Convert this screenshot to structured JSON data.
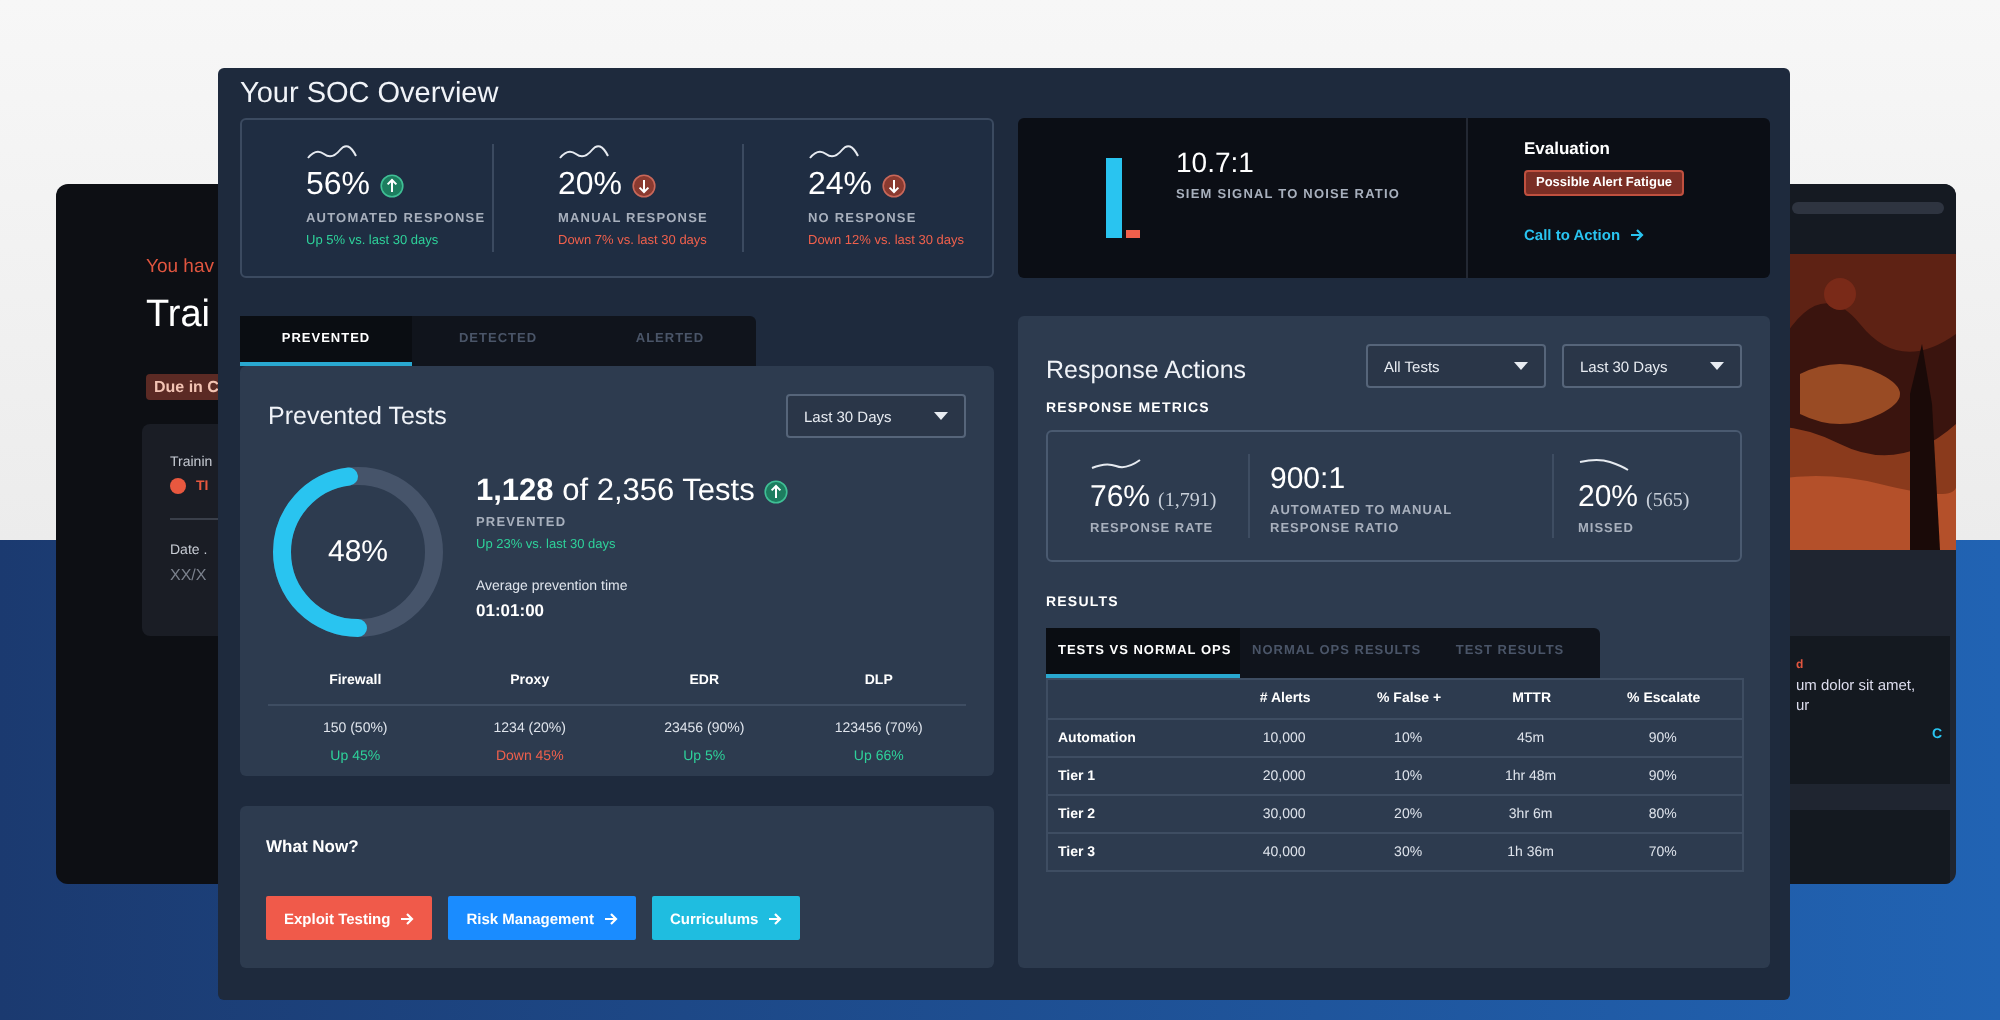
{
  "back_left_card": {
    "notice": "You hav",
    "title": "Trai",
    "badge": "Due in C",
    "field_label": "Trainin",
    "status": "TI",
    "date_label": "Date .",
    "date_value": "XX/X"
  },
  "back_right_card": {
    "tag": "d",
    "lines": "um dolor sit amet,\nur",
    "link": "C"
  },
  "window": {
    "title": "Your SOC Overview"
  },
  "overview_metrics": [
    {
      "value": "56%",
      "rising": true,
      "label": "AUTOMATED RESPONSE",
      "delta": "Up 5% vs. last 30 days"
    },
    {
      "value": "20%",
      "rising": false,
      "label": "MANUAL RESPONSE",
      "delta": "Down 7% vs. last 30 days"
    },
    {
      "value": "24%",
      "rising": false,
      "label": "NO RESPONSE",
      "delta": "Down 12% vs. last 30 days"
    }
  ],
  "siem": {
    "ratio": "10.7:1",
    "label": "SIEM SIGNAL TO NOISE RATIO",
    "evaluation_title": "Evaluation",
    "badge": "Possible Alert Fatigue",
    "link": "Call to Action"
  },
  "tabs": [
    {
      "label": "PREVENTED",
      "selected": true
    },
    {
      "label": "DETECTED",
      "selected": false
    },
    {
      "label": "ALERTED",
      "selected": false
    }
  ],
  "prevented": {
    "title": "Prevented Tests",
    "period": "Last 30 Days",
    "level": 0.48,
    "percent": "48%",
    "count": "1,128",
    "total": "of 2,356 Tests",
    "rising": true,
    "status": "PREVENTED",
    "delta": "Up 23% vs. last 30 days",
    "avg_label": "Average prevention time",
    "avg_value": "01:01:00",
    "controls": [
      {
        "name": "Firewall",
        "value": "150 (50%)",
        "change": "Up 45%",
        "rising": true
      },
      {
        "name": "Proxy",
        "value": "1234 (20%)",
        "change": "Down 45%",
        "rising": false
      },
      {
        "name": "EDR",
        "value": "23456 (90%)",
        "change": "Up 5%",
        "rising": true
      },
      {
        "name": "DLP",
        "value": "123456 (70%)",
        "change": "Up 66%",
        "rising": true
      }
    ]
  },
  "what_now": {
    "title": "What Now?",
    "buttons": [
      {
        "label": "Exploit Testing",
        "color": "#f05a4a"
      },
      {
        "label": "Risk Management",
        "color": "#1a8cff"
      },
      {
        "label": "Curriculums",
        "color": "#1fbde0"
      }
    ]
  },
  "response_actions": {
    "title": "Response Actions",
    "filters": [
      "All Tests",
      "Last 30 Days"
    ],
    "metrics_heading": "RESPONSE METRICS",
    "metrics": [
      {
        "kind": "trend",
        "value": "76%",
        "count": "(1,791)",
        "label": "RESPONSE RATE"
      },
      {
        "kind": "ratio",
        "value": "900:1",
        "label": "AUTOMATED TO MANUAL RESPONSE RATIO"
      },
      {
        "kind": "trend",
        "value": "20%",
        "count": "(565)",
        "label": "MISSED"
      }
    ],
    "results_heading": "RESULTS",
    "tabs": [
      {
        "label": "TESTS VS NORMAL OPS",
        "selected": true
      },
      {
        "label": "NORMAL OPS RESULTS",
        "selected": false
      },
      {
        "label": "TEST RESULTS",
        "selected": false
      }
    ],
    "table": {
      "columns": [
        "# Alerts",
        "% False +",
        "MTTR",
        "% Escalate"
      ],
      "rows": [
        {
          "label": "Automation",
          "cells": [
            "10,000",
            "10%",
            "45m",
            "90%"
          ]
        },
        {
          "label": "Tier 1",
          "cells": [
            "20,000",
            "10%",
            "1hr 48m",
            "90%"
          ]
        },
        {
          "label": "Tier 2",
          "cells": [
            "30,000",
            "20%",
            "3hr 6m",
            "80%"
          ]
        },
        {
          "label": "Tier 3",
          "cells": [
            "40,000",
            "30%",
            "1h 36m",
            "70%"
          ]
        }
      ]
    }
  }
}
